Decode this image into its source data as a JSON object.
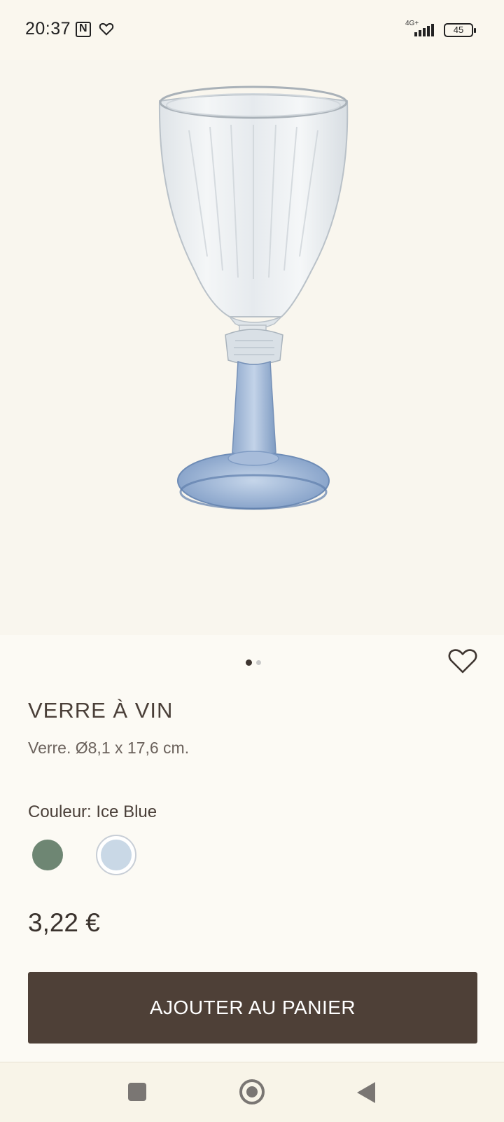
{
  "status_bar": {
    "time": "20:37",
    "network": "4G+",
    "battery": "45"
  },
  "product": {
    "title": "VERRE À VIN",
    "description": "Verre. Ø8,1 x 17,6 cm.",
    "color_label": "Couleur: Ice Blue",
    "price": "3,22 €",
    "add_to_cart_label": "AJOUTER AU PANIER",
    "image_count": 2,
    "current_image": 1,
    "swatches": [
      {
        "name": "green",
        "color": "#6e8673",
        "selected": false
      },
      {
        "name": "ice-blue",
        "color": "#c9d8e6",
        "selected": true
      }
    ]
  },
  "colors": {
    "background": "#fcfaf4",
    "button": "#4e4037",
    "text": "#4a3f38"
  },
  "icons": [
    "nfc-icon",
    "heart-icon",
    "signal-icon",
    "battery-icon",
    "wishlist-heart-icon",
    "recents-icon",
    "home-icon",
    "back-icon"
  ]
}
